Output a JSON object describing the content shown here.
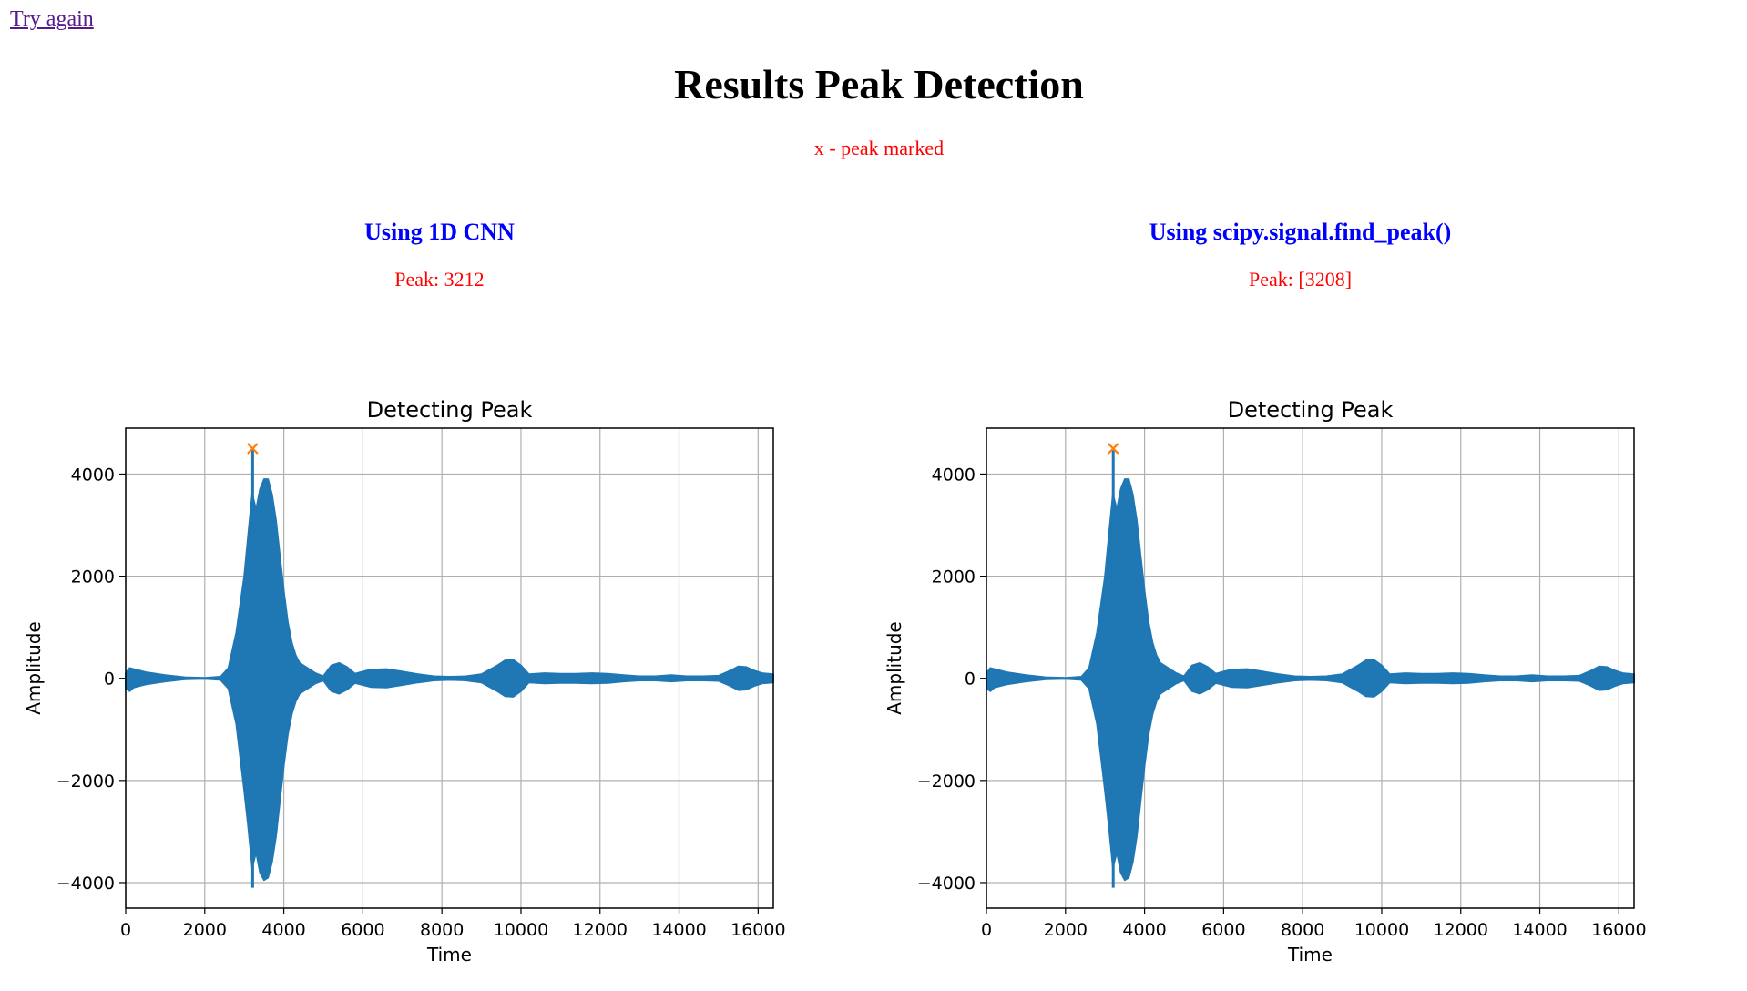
{
  "nav": {
    "try_again": "Try again"
  },
  "page": {
    "title": "Results Peak Detection",
    "note": "x - peak marked"
  },
  "panels": [
    {
      "heading": "Using 1D CNN",
      "peak_text": "Peak: 3212"
    },
    {
      "heading": "Using scipy.signal.find_peak()",
      "peak_text": "Peak: [3208]"
    }
  ],
  "colors": {
    "signal": "#1f77b4",
    "peak_marker": "#ff7f0e",
    "heading": "#0000ff",
    "note": "#ff0000",
    "link": "#551a8b"
  },
  "chart_data": [
    {
      "type": "line",
      "title": "Detecting Peak",
      "xlabel": "Time",
      "ylabel": "Amplitude",
      "xlim": [
        0,
        16384
      ],
      "ylim": [
        -4500,
        4900
      ],
      "xticks": [
        0,
        2000,
        4000,
        6000,
        8000,
        10000,
        12000,
        14000,
        16000
      ],
      "yticks": [
        -4000,
        -2000,
        0,
        2000,
        4000
      ],
      "ytick_labels": [
        "−4000",
        "−2000",
        "0",
        "2000",
        "4000"
      ],
      "grid": true,
      "envelope": {
        "x": [
          0,
          100,
          200,
          500,
          1000,
          1500,
          2000,
          2400,
          2600,
          2800,
          3000,
          3100,
          3200,
          3300,
          3400,
          3500,
          3600,
          3700,
          3800,
          3900,
          4000,
          4100,
          4200,
          4300,
          4400,
          4600,
          4800,
          5000,
          5200,
          5400,
          5600,
          5800,
          6000,
          6200,
          6600,
          7000,
          7400,
          7800,
          8200,
          8600,
          9000,
          9400,
          9600,
          9800,
          10000,
          10200,
          10600,
          11000,
          11400,
          11800,
          12200,
          12600,
          13000,
          13400,
          13800,
          14200,
          14600,
          15000,
          15300,
          15500,
          15700,
          15900,
          16100,
          16384
        ],
        "upper": [
          100,
          200,
          180,
          120,
          60,
          20,
          10,
          30,
          200,
          900,
          2000,
          2800,
          3600,
          3300,
          3700,
          3900,
          3900,
          3600,
          3100,
          2400,
          1700,
          1100,
          700,
          450,
          300,
          200,
          100,
          40,
          250,
          300,
          220,
          90,
          130,
          170,
          180,
          130,
          80,
          40,
          30,
          40,
          80,
          250,
          350,
          360,
          250,
          80,
          100,
          90,
          90,
          100,
          90,
          60,
          40,
          40,
          60,
          40,
          40,
          50,
          150,
          230,
          220,
          150,
          100,
          80
        ],
        "lower": [
          -200,
          -250,
          -180,
          -120,
          -60,
          -20,
          -10,
          -30,
          -200,
          -900,
          -2200,
          -2900,
          -3700,
          -3400,
          -3800,
          -3950,
          -3900,
          -3600,
          -3100,
          -2400,
          -1700,
          -1100,
          -700,
          -450,
          -300,
          -200,
          -100,
          -40,
          -250,
          -300,
          -220,
          -90,
          -130,
          -170,
          -180,
          -130,
          -80,
          -40,
          -30,
          -40,
          -80,
          -250,
          -350,
          -360,
          -250,
          -80,
          -100,
          -90,
          -90,
          -100,
          -90,
          -60,
          -40,
          -40,
          -60,
          -40,
          -40,
          -50,
          -150,
          -230,
          -220,
          -150,
          -100,
          -80
        ]
      },
      "spikes": [
        {
          "x": 3212,
          "y": 4500
        },
        {
          "x": 3212,
          "y": -4100
        }
      ],
      "peak_marker": {
        "x": 3212,
        "y": 4500,
        "symbol": "x"
      }
    },
    {
      "type": "line",
      "title": "Detecting Peak",
      "xlabel": "Time",
      "ylabel": "Amplitude",
      "xlim": [
        0,
        16384
      ],
      "ylim": [
        -4500,
        4900
      ],
      "xticks": [
        0,
        2000,
        4000,
        6000,
        8000,
        10000,
        12000,
        14000,
        16000
      ],
      "yticks": [
        -4000,
        -2000,
        0,
        2000,
        4000
      ],
      "ytick_labels": [
        "−4000",
        "−2000",
        "0",
        "2000",
        "4000"
      ],
      "grid": true,
      "envelope": {
        "x": [
          0,
          100,
          200,
          500,
          1000,
          1500,
          2000,
          2400,
          2600,
          2800,
          3000,
          3100,
          3200,
          3300,
          3400,
          3500,
          3600,
          3700,
          3800,
          3900,
          4000,
          4100,
          4200,
          4300,
          4400,
          4600,
          4800,
          5000,
          5200,
          5400,
          5600,
          5800,
          6000,
          6200,
          6600,
          7000,
          7400,
          7800,
          8200,
          8600,
          9000,
          9400,
          9600,
          9800,
          10000,
          10200,
          10600,
          11000,
          11400,
          11800,
          12200,
          12600,
          13000,
          13400,
          13800,
          14200,
          14600,
          15000,
          15300,
          15500,
          15700,
          15900,
          16100,
          16384
        ],
        "upper": [
          100,
          200,
          180,
          120,
          60,
          20,
          10,
          30,
          200,
          900,
          2000,
          2800,
          3600,
          3300,
          3700,
          3900,
          3900,
          3600,
          3100,
          2400,
          1700,
          1100,
          700,
          450,
          300,
          200,
          100,
          40,
          250,
          300,
          220,
          90,
          130,
          170,
          180,
          130,
          80,
          40,
          30,
          40,
          80,
          250,
          350,
          360,
          250,
          80,
          100,
          90,
          90,
          100,
          90,
          60,
          40,
          40,
          60,
          40,
          40,
          50,
          150,
          230,
          220,
          150,
          100,
          80
        ],
        "lower": [
          -200,
          -250,
          -180,
          -120,
          -60,
          -20,
          -10,
          -30,
          -200,
          -900,
          -2200,
          -2900,
          -3700,
          -3400,
          -3800,
          -3950,
          -3900,
          -3600,
          -3100,
          -2400,
          -1700,
          -1100,
          -700,
          -450,
          -300,
          -200,
          -100,
          -40,
          -250,
          -300,
          -220,
          -90,
          -130,
          -170,
          -180,
          -130,
          -80,
          -40,
          -30,
          -40,
          -80,
          -250,
          -350,
          -360,
          -250,
          -80,
          -100,
          -90,
          -90,
          -100,
          -90,
          -60,
          -40,
          -40,
          -60,
          -40,
          -40,
          -50,
          -150,
          -230,
          -220,
          -150,
          -100,
          -80
        ]
      },
      "spikes": [
        {
          "x": 3208,
          "y": 4500
        },
        {
          "x": 3208,
          "y": -4100
        }
      ],
      "peak_marker": {
        "x": 3208,
        "y": 4500,
        "symbol": "x"
      }
    }
  ]
}
